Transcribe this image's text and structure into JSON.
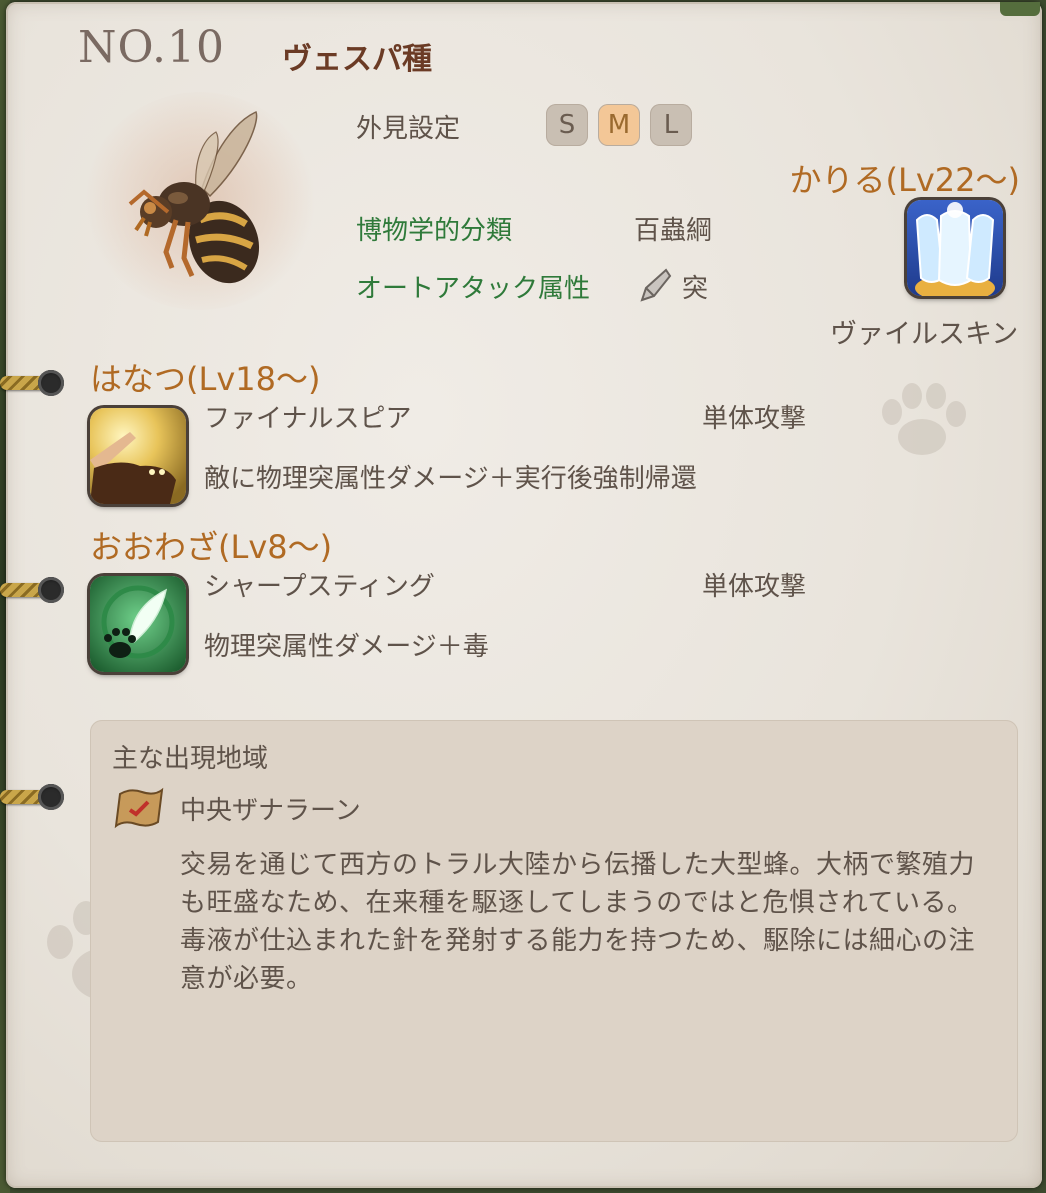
{
  "entry": {
    "number": "NO.10",
    "species": "ヴェスパ種"
  },
  "appearance": {
    "label": "外見設定",
    "sizes": [
      "S",
      "M",
      "L"
    ],
    "selected": "M"
  },
  "classification": {
    "label": "博物学的分類",
    "value": "百蟲綱"
  },
  "auto_attack": {
    "label": "オートアタック属性",
    "icon": "pierce-icon",
    "value": "突"
  },
  "summon": {
    "title": "かりる(Lv22～)",
    "icon": "vile-skin-icon",
    "label": "ヴァイルスキン"
  },
  "skills": [
    {
      "section_title": "はなつ(Lv18～)",
      "icon": "final-spear-icon",
      "name": "ファイナルスピア",
      "type": "単体攻撃",
      "description": "敵に物理突属性ダメージ＋実行後強制帰還"
    },
    {
      "section_title": "おおわざ(Lv8～)",
      "icon": "sharp-sting-icon",
      "name": "シャープスティング",
      "type": "単体攻撃",
      "description": "物理突属性ダメージ＋毒"
    }
  ],
  "habitat": {
    "heading": "主な出現地域",
    "icon": "map-scroll-icon",
    "region": "中央ザナラーン",
    "description": "交易を通じて西方のトラル大陸から伝播した大型蜂。大柄で繁殖力も旺盛なため、在来種を駆逐してしまうのではと危惧されている。毒液が仕込まれた針を発射する能力を持つため、駆除には細心の注意が必要。"
  },
  "colors": {
    "section_title": "#b06a23",
    "green_label": "#2f7a3a",
    "species": "#6b3b25",
    "size_active": "#f3c797"
  }
}
